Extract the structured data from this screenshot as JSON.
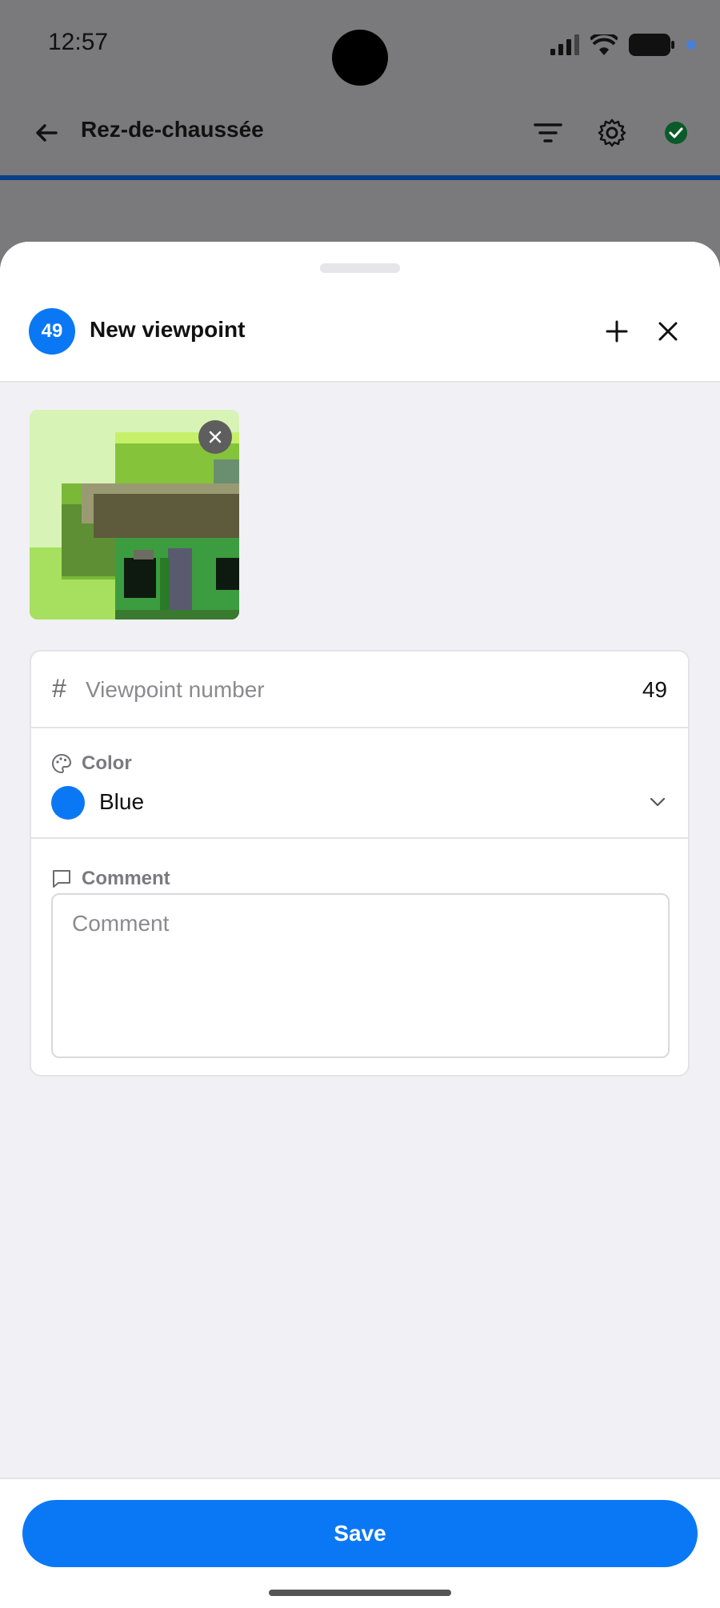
{
  "status_bar": {
    "time": "12:57"
  },
  "app_bar": {
    "title": "Rez-de-chaussée"
  },
  "sheet": {
    "badge_number": "49",
    "title": "New viewpoint",
    "viewpoint_number_label": "Viewpoint number",
    "viewpoint_number_value": "49",
    "color_label": "Color",
    "color_value": "Blue",
    "color_hex": "#0a78f5",
    "comment_label": "Comment",
    "comment_placeholder": "Comment",
    "comment_value": ""
  },
  "footer": {
    "save_label": "Save"
  },
  "colors": {
    "accent": "#0a78f5",
    "status_ok": "#0a8a3a"
  },
  "icons": [
    "back-arrow-icon",
    "filter-icon",
    "gear-icon",
    "check-circle-icon",
    "plus-icon",
    "close-icon",
    "palette-icon",
    "chat-bubble-icon",
    "chevron-down-icon"
  ]
}
